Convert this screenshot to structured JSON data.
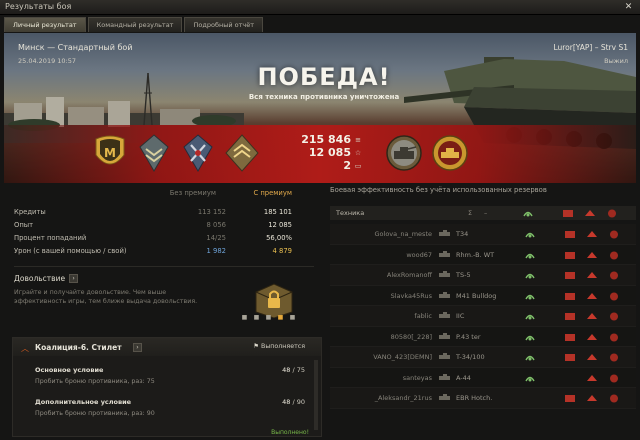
{
  "window": {
    "title": "Результаты боя",
    "close_glyph": "✕"
  },
  "tabs": [
    {
      "label": "Личный результат",
      "active": true
    },
    {
      "label": "Командный результат",
      "active": false
    },
    {
      "label": "Подробный отчёт",
      "active": false
    }
  ],
  "banner": {
    "map": "Минск — Стандартный бой",
    "datetime": "25.04.2019 10:57",
    "player": "Luror[YAP] – Strv S1",
    "player_status": "Выжил",
    "result_title": "ПОБЕДА!",
    "result_subtitle": "Вся техника противника уничтожена"
  },
  "rewards": {
    "credits": "215 846",
    "experience": "12 085",
    "free": "2",
    "credits_icon": "credits-coin-icon",
    "xp_icon": "star-icon",
    "free_icon": "ticket-icon"
  },
  "medals": [
    "mastery-badge-m",
    "chevron-medal",
    "cross-medal",
    "rank-insignia"
  ],
  "achievements": [
    "tank-achievement-badge",
    "tank-gold-badge"
  ],
  "stats": {
    "header_nopremium": "Без премиум",
    "header_premium": "С премиум",
    "rows": [
      {
        "label": "Кредиты",
        "nopremium": "113 152",
        "premium": "185 101",
        "icon": "credits-coin-icon"
      },
      {
        "label": "Опыт",
        "nopremium": "8 056",
        "premium": "12 085",
        "icon": "star-icon"
      },
      {
        "label": "Процент попаданий",
        "nopremium": "14/25",
        "premium": "56,00%",
        "icon": ""
      },
      {
        "label": "Урон (с вашей помощью / свой)",
        "nopremium": "1 982",
        "premium": "4 879",
        "icon": ""
      }
    ]
  },
  "satisfaction": {
    "title": "Довольствие",
    "button": "›",
    "description": "Играйте и получайте довольствие. Чем выше эффективность игры, тем ближе выдача довольствия."
  },
  "mission": {
    "title": "Коалиция-6. Стилет",
    "button": "›",
    "status": "Выполняется",
    "done": "Выполнено!",
    "conditions": [
      {
        "title": "Основное условие",
        "desc": "Пробить броню противника, раз: 75",
        "progress_done": "48",
        "progress_total": " / 75"
      },
      {
        "title": "Дополнительное условие",
        "desc": "Пробить броню противника, раз: 90",
        "progress_done": "48",
        "progress_total": " / 90"
      }
    ]
  },
  "right_panel": {
    "header": "Боевая эффективность без учёта использованных резервов",
    "col_tech": "Техника",
    "col_icons": [
      "Σ",
      "–"
    ]
  },
  "enemies": [
    {
      "player": "Golova_na_meste",
      "vehicle": "T34"
    },
    {
      "player": "wood67",
      "vehicle": "Rhm.-B. WT"
    },
    {
      "player": "AlexRomanoff",
      "vehicle": "TS-5"
    },
    {
      "player": "Slavka45Rus",
      "vehicle": "M41 Bulldog"
    },
    {
      "player": "fablic",
      "vehicle": "IIC"
    },
    {
      "player": "80580[_228]",
      "vehicle": "P.43 ter"
    },
    {
      "player": "VANO_423[DEMN]",
      "vehicle": "T-34/100"
    },
    {
      "player": "santeyas",
      "vehicle": "A-44"
    },
    {
      "player": "_Aleksandr_21rus",
      "vehicle": "EBR Hotch."
    }
  ]
}
